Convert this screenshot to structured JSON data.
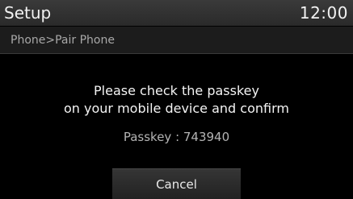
{
  "header": {
    "title": "Setup",
    "clock": "12:00"
  },
  "breadcrumb": {
    "path": "Phone>Pair Phone"
  },
  "dialog": {
    "message_line1": "Please check the passkey",
    "message_line2": "on your mobile device and confirm",
    "passkey": "Passkey : 743940",
    "cancel_label": "Cancel"
  }
}
